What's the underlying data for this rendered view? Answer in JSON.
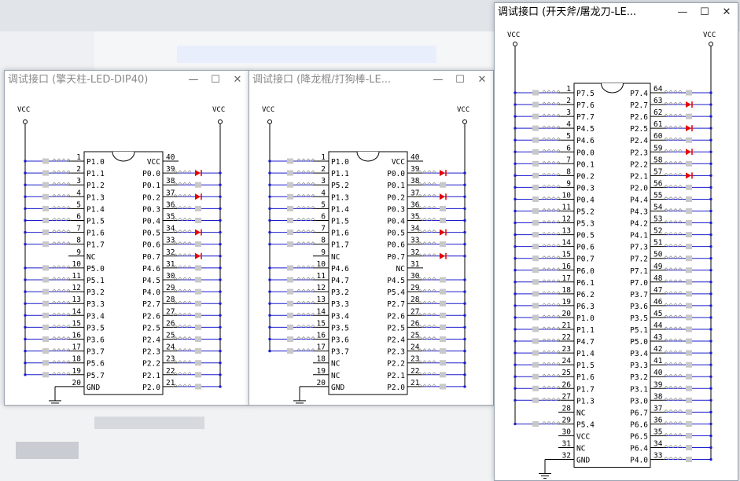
{
  "windows": [
    {
      "title": "调试接口 (擎天柱-LED-DIP40)",
      "active": false,
      "pins_per_side": 20,
      "vcc_left": "VCC",
      "vcc_right": "VCC",
      "left_pins": [
        "P1.0",
        "P1.1",
        "P1.2",
        "P1.3",
        "P1.4",
        "P1.5",
        "P1.6",
        "P1.7",
        "NC",
        "P5.0",
        "P5.1",
        "P3.2",
        "P3.3",
        "P3.4",
        "P3.5",
        "P3.6",
        "P3.7",
        "P5.6",
        "P5.7",
        "GND"
      ],
      "right_pins": [
        "VCC",
        "P0.0",
        "P0.1",
        "P0.2",
        "P0.3",
        "P0.4",
        "P0.5",
        "P0.6",
        "P0.7",
        "P4.6",
        "P4.5",
        "P4.0",
        "P2.7",
        "P2.6",
        "P2.5",
        "P2.4",
        "P2.3",
        "P2.2",
        "P2.1",
        "P2.0"
      ],
      "left_leds": [
        1,
        1,
        1,
        1,
        1,
        1,
        1,
        1,
        0,
        1,
        1,
        1,
        1,
        1,
        1,
        1,
        1,
        1,
        1,
        0
      ],
      "right_leds": [
        0,
        1,
        1,
        1,
        1,
        1,
        1,
        1,
        1,
        1,
        1,
        1,
        1,
        1,
        1,
        1,
        1,
        1,
        1,
        1
      ],
      "lit_right": [
        1,
        3,
        6,
        8
      ],
      "lit_left": []
    },
    {
      "title": "调试接口 (降龙棍/打狗棒-LE...",
      "active": false,
      "pins_per_side": 20,
      "vcc_left": "VCC",
      "vcc_right": "VCC",
      "left_pins": [
        "P1.0",
        "P1.1",
        "P5.2",
        "P1.3",
        "P1.4",
        "P1.5",
        "P1.6",
        "P1.7",
        "NC",
        "P4.6",
        "P4.7",
        "P3.2",
        "P3.3",
        "P3.4",
        "P3.5",
        "P3.6",
        "P3.7",
        "NC",
        "NC",
        "GND"
      ],
      "right_pins": [
        "VCC",
        "P0.0",
        "P0.1",
        "P0.2",
        "P0.3",
        "P0.4",
        "P0.5",
        "P0.6",
        "P0.7",
        "NC",
        "P4.5",
        "P5.4",
        "P2.7",
        "P2.6",
        "P2.5",
        "P2.4",
        "P2.3",
        "P2.2",
        "P2.1",
        "P2.0"
      ],
      "left_leds": [
        1,
        1,
        1,
        1,
        1,
        1,
        1,
        1,
        0,
        1,
        1,
        1,
        1,
        1,
        1,
        1,
        1,
        0,
        0,
        0
      ],
      "right_leds": [
        0,
        1,
        1,
        1,
        1,
        1,
        1,
        1,
        1,
        0,
        1,
        1,
        1,
        1,
        1,
        1,
        1,
        1,
        1,
        1
      ],
      "lit_right": [
        1,
        3,
        6,
        8
      ],
      "lit_left": []
    },
    {
      "title": "调试接口 (开天斧/屠龙刀-LE...",
      "active": true,
      "pins_per_side": 32,
      "vcc_left": "VCC",
      "vcc_right": "VCC",
      "left_pins": [
        "P7.5",
        "P7.6",
        "P7.7",
        "P4.5",
        "P4.6",
        "P0.0",
        "P0.1",
        "P0.2",
        "P0.3",
        "P0.4",
        "P5.2",
        "P5.3",
        "P0.5",
        "P0.6",
        "P0.7",
        "P6.0",
        "P6.1",
        "P6.2",
        "P6.3",
        "P1.0",
        "P1.1",
        "P4.7",
        "P1.4",
        "P1.5",
        "P1.6",
        "P1.7",
        "P1.3",
        "NC",
        "P5.4",
        "VCC",
        "NC",
        "GND"
      ],
      "right_pins": [
        "P7.4",
        "P2.7",
        "P2.6",
        "P2.5",
        "P2.4",
        "P2.3",
        "P2.2",
        "P2.1",
        "P2.0",
        "P4.4",
        "P4.3",
        "P4.2",
        "P4.1",
        "P7.3",
        "P7.2",
        "P7.1",
        "P7.0",
        "P3.7",
        "P3.6",
        "P3.5",
        "P5.1",
        "P5.0",
        "P3.4",
        "P3.3",
        "P3.2",
        "P3.1",
        "P3.0",
        "P6.7",
        "P6.6",
        "P6.5",
        "P6.4",
        "P4.0"
      ],
      "left_leds": [
        1,
        1,
        1,
        1,
        1,
        1,
        1,
        1,
        1,
        1,
        1,
        1,
        1,
        1,
        1,
        1,
        1,
        1,
        1,
        1,
        1,
        1,
        1,
        1,
        1,
        1,
        1,
        0,
        1,
        0,
        0,
        0
      ],
      "right_leds": [
        1,
        1,
        1,
        1,
        1,
        1,
        1,
        1,
        1,
        1,
        1,
        1,
        1,
        1,
        1,
        1,
        1,
        1,
        1,
        1,
        1,
        1,
        1,
        1,
        1,
        1,
        1,
        1,
        1,
        1,
        1,
        1
      ],
      "lit_right": [
        1,
        3,
        5,
        7
      ],
      "lit_left": []
    }
  ],
  "colors": {
    "wire": "#1c1ccc",
    "led_off": "#c8c8c8",
    "led_on": "#e60000",
    "line": "#000000"
  }
}
